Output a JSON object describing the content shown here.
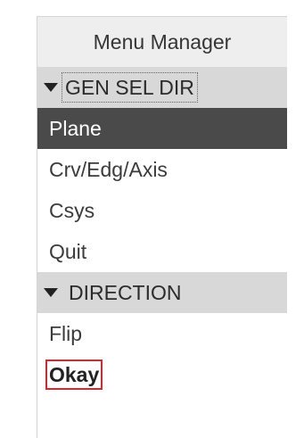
{
  "menu": {
    "title": "Menu Manager",
    "sections": [
      {
        "header": "GEN SEL DIR",
        "items": [
          "Plane",
          "Crv/Edg/Axis",
          "Csys",
          "Quit"
        ],
        "selected_item": "Plane"
      },
      {
        "header": "DIRECTION",
        "items": [
          "Flip",
          "Okay"
        ],
        "highlighted_item": "Okay"
      }
    ]
  },
  "colors": {
    "selected_bg": "#4a4a4a",
    "section_header_bg": "#d8d8d8",
    "title_bg": "#eeeeee",
    "highlight_border": "#d9262e"
  },
  "icons": {
    "expand": "caret-down-icon"
  }
}
